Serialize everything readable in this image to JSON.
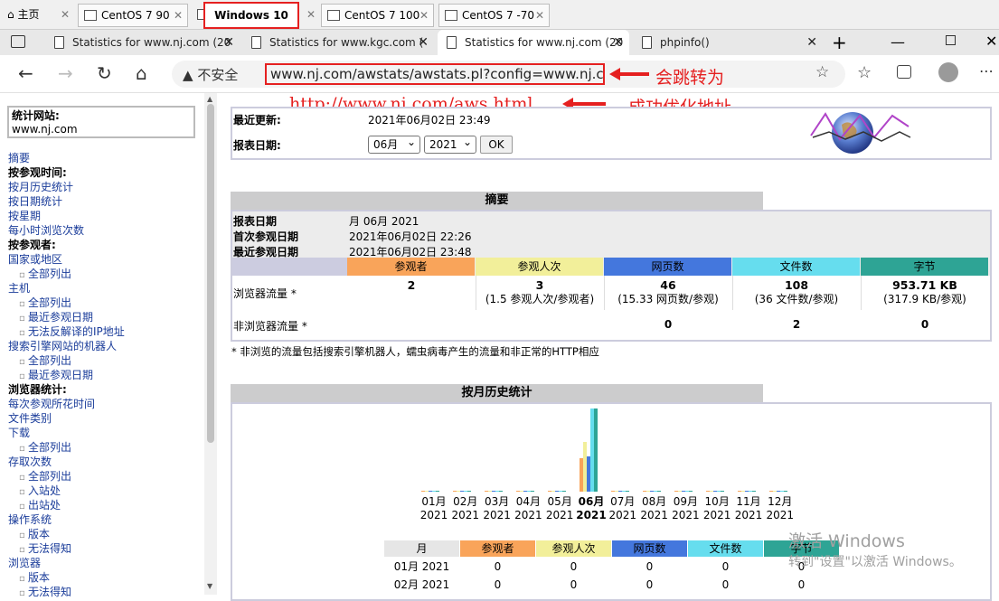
{
  "vm_tabs": [
    {
      "label": "主页"
    },
    {
      "label": "CentOS 7 90"
    },
    {
      "label": "Windows 10 x64"
    },
    {
      "label": "CentOS 7 100"
    },
    {
      "label": "CentOS 7 -70"
    }
  ],
  "browser_tabs": [
    {
      "label": "Statistics for www.nj.com (20"
    },
    {
      "label": "Statistics for www.kgc.com ("
    },
    {
      "label": "Statistics for www.nj.com (20"
    },
    {
      "label": "phpinfo()"
    }
  ],
  "address": {
    "insecure": "不安全",
    "url": "www.nj.com/awstats/awstats.pl?config=www.nj.com"
  },
  "annotations": {
    "redirect": "会跳转为",
    "new_url": "http://www.nj.com/aws.html",
    "optimized": "成功优化地址"
  },
  "sidebar": {
    "site_label": "统计网站:",
    "site_value": "www.nj.com",
    "items": [
      {
        "label": "摘要",
        "type": "link"
      },
      {
        "label": "按参观时间:",
        "type": "head"
      },
      {
        "label": "按月历史统计",
        "type": "link"
      },
      {
        "label": "按日期统计",
        "type": "link"
      },
      {
        "label": "按星期",
        "type": "link"
      },
      {
        "label": "每小时浏览次数",
        "type": "link"
      },
      {
        "label": "按参观者:",
        "type": "head"
      },
      {
        "label": "国家或地区",
        "type": "link"
      },
      {
        "label": "全部列出",
        "type": "sub"
      },
      {
        "label": "主机",
        "type": "link"
      },
      {
        "label": "全部列出",
        "type": "sub"
      },
      {
        "label": "最近参观日期",
        "type": "sub"
      },
      {
        "label": "无法反解译的IP地址",
        "type": "sub"
      },
      {
        "label": "搜索引擎网站的机器人",
        "type": "link"
      },
      {
        "label": "全部列出",
        "type": "sub"
      },
      {
        "label": "最近参观日期",
        "type": "sub"
      },
      {
        "label": "浏览器统计:",
        "type": "head"
      },
      {
        "label": "每次参观所花时间",
        "type": "link"
      },
      {
        "label": "文件类别",
        "type": "link"
      },
      {
        "label": "下载",
        "type": "link"
      },
      {
        "label": "全部列出",
        "type": "sub"
      },
      {
        "label": "存取次数",
        "type": "link"
      },
      {
        "label": "全部列出",
        "type": "sub"
      },
      {
        "label": "入站处",
        "type": "sub"
      },
      {
        "label": "出站处",
        "type": "sub"
      },
      {
        "label": "操作系统",
        "type": "link"
      },
      {
        "label": "版本",
        "type": "sub"
      },
      {
        "label": "无法得知",
        "type": "sub"
      },
      {
        "label": "浏览器",
        "type": "link"
      },
      {
        "label": "版本",
        "type": "sub"
      },
      {
        "label": "无法得知",
        "type": "sub"
      }
    ]
  },
  "header": {
    "last_update_label": "最近更新:",
    "last_update_value": "2021年06月02日 23:49",
    "report_label": "报表日期:",
    "month": "06月",
    "year": "2021",
    "ok": "OK"
  },
  "summary": {
    "title": "摘要",
    "report_date_label": "报表日期",
    "report_date_value": "月 06月 2021",
    "first_visit_label": "首次参观日期",
    "first_visit_value": "2021年06月02日 22:26",
    "last_visit_label": "最近参观日期",
    "last_visit_value": "2021年06月02日 23:48",
    "columns": [
      {
        "label": "参观者",
        "color": "#f9a45a"
      },
      {
        "label": "参观人次",
        "color": "#f2ef9a"
      },
      {
        "label": "网页数",
        "color": "#4477dd"
      },
      {
        "label": "文件数",
        "color": "#66ddee"
      },
      {
        "label": "字节",
        "color": "#2ea495"
      }
    ],
    "browser_label": "浏览器流量 *",
    "browser_values": [
      "2",
      "3",
      "46",
      "108",
      "953.71 KB"
    ],
    "browser_subs": [
      "",
      "(1.5 参观人次/参观者)",
      "(15.33 网页数/参观)",
      "(36 文件数/参观)",
      "(317.9 KB/参观)"
    ],
    "nonbrowser_label": "非浏览器流量 *",
    "nonbrowser_values": [
      "",
      "",
      "0",
      "2",
      "0"
    ],
    "footnote": "* 非浏览的流量包括搜索引擎机器人，蠕虫病毒产生的流量和非正常的HTTP相应"
  },
  "monthly": {
    "title": "按月历史统计",
    "months": [
      "01月",
      "02月",
      "03月",
      "04月",
      "05月",
      "06月",
      "07月",
      "08月",
      "09月",
      "10月",
      "11月",
      "12月"
    ],
    "year": "2021",
    "current_month_index": 5,
    "table_headers": [
      "月",
      "参观者",
      "参观人次",
      "网页数",
      "文件数",
      "字节"
    ],
    "rows": [
      {
        "month": "01月 2021",
        "values": [
          "0",
          "0",
          "0",
          "0",
          "0"
        ]
      },
      {
        "month": "02月 2021",
        "values": [
          "0",
          "0",
          "0",
          "0",
          "0"
        ]
      }
    ]
  },
  "chart_data": {
    "type": "bar",
    "categories": [
      "01月",
      "02月",
      "03月",
      "04月",
      "05月",
      "06月",
      "07月",
      "08月",
      "09月",
      "10月",
      "11月",
      "12月"
    ],
    "series": [
      {
        "name": "参观者",
        "values": [
          0,
          0,
          0,
          0,
          0,
          2,
          0,
          0,
          0,
          0,
          0,
          0
        ]
      },
      {
        "name": "参观人次",
        "values": [
          0,
          0,
          0,
          0,
          0,
          3,
          0,
          0,
          0,
          0,
          0,
          0
        ]
      },
      {
        "name": "网页数",
        "values": [
          0,
          0,
          0,
          0,
          0,
          46,
          0,
          0,
          0,
          0,
          0,
          0
        ]
      },
      {
        "name": "文件数",
        "values": [
          0,
          0,
          0,
          0,
          0,
          108,
          0,
          0,
          0,
          0,
          0,
          0
        ]
      },
      {
        "name": "字节",
        "values": [
          0,
          0,
          0,
          0,
          0,
          953.71,
          0,
          0,
          0,
          0,
          0,
          0
        ]
      }
    ]
  },
  "watermark": {
    "line1": "激活 Windows",
    "line2": "转到\"设置\"以激活 Windows。"
  }
}
